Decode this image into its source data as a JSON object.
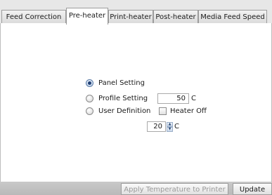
{
  "tabs": [
    {
      "label": "Feed Correction",
      "active": false
    },
    {
      "label": "Pre-heater",
      "active": true
    },
    {
      "label": "Print-heater",
      "active": false
    },
    {
      "label": "Post-heater",
      "active": false
    },
    {
      "label": "Media Feed Speed",
      "active": false
    }
  ],
  "options": {
    "selected": "panel_setting",
    "panel_setting": {
      "label": "Panel Setting"
    },
    "profile_setting": {
      "label": "Profile Setting",
      "value": "50",
      "unit": "C"
    },
    "user_definition": {
      "label": "User Definition",
      "heater_off_label": "Heater Off",
      "heater_off_checked": false,
      "value": "20",
      "unit": "C"
    }
  },
  "buttons": {
    "apply_label": "Apply Temperature to Printer",
    "apply_enabled": false,
    "update_label": "Update"
  },
  "icons": {
    "spin_up": "spin-up-arrow-icon",
    "spin_down": "spin-down-arrow-icon"
  }
}
